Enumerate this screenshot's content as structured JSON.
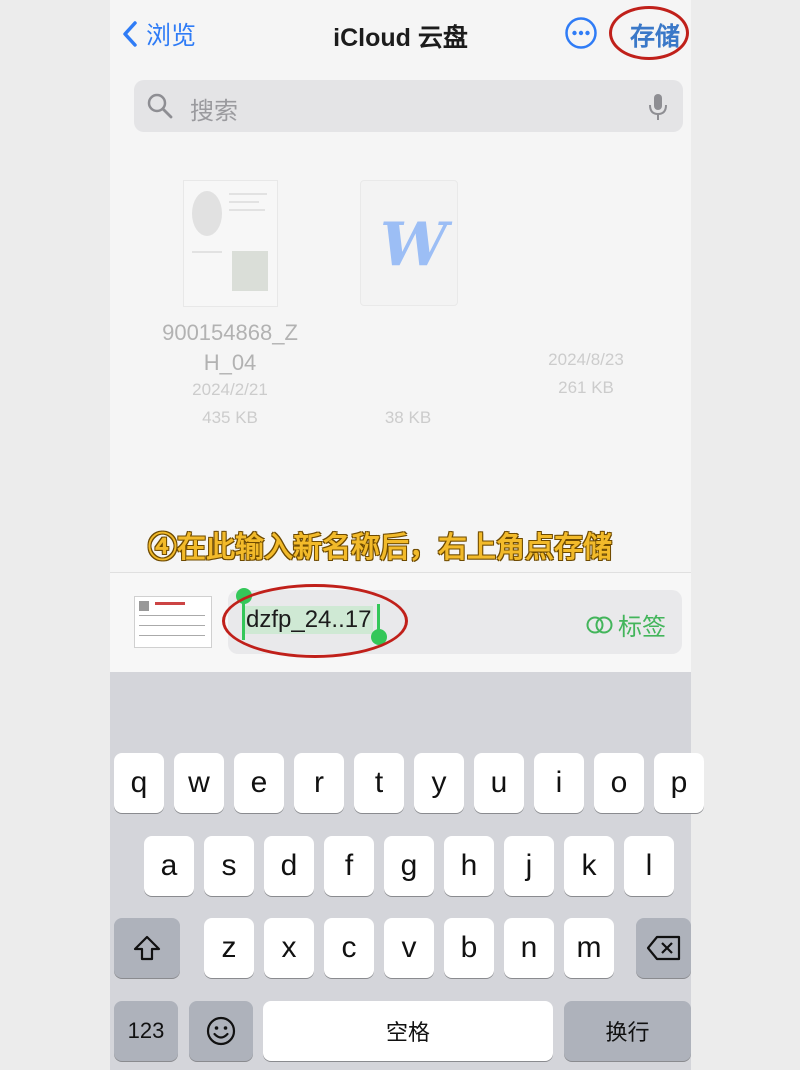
{
  "nav": {
    "back_label": "浏览",
    "title": "iCloud 云盘",
    "save_label": "存储"
  },
  "search": {
    "placeholder": "搜索"
  },
  "files": [
    {
      "name_line1": "900154868_Z",
      "name_line2": "H_04",
      "date": "2024/2/21",
      "size": "435 KB"
    },
    {
      "name_line1": "",
      "name_line2": "",
      "date": "",
      "size": "38 KB"
    },
    {
      "name_line1": "",
      "name_line2": "",
      "date": "2024/8/23",
      "size": "261 KB"
    }
  ],
  "annotation": "④在此输入新名称后，右上角点存储",
  "rename": {
    "value": "dzfp_24..17",
    "tag_label": "标签"
  },
  "keyboard": {
    "row1": [
      "q",
      "w",
      "e",
      "r",
      "t",
      "y",
      "u",
      "i",
      "o",
      "p"
    ],
    "row2": [
      "a",
      "s",
      "d",
      "f",
      "g",
      "h",
      "j",
      "k",
      "l"
    ],
    "row3": [
      "z",
      "x",
      "c",
      "v",
      "b",
      "n",
      "m"
    ],
    "numbers": "123",
    "space": "空格",
    "return": "换行"
  },
  "colors": {
    "accent": "#2f7cf6",
    "annotation": "#f2ba2a",
    "highlight_circle": "#c0201a",
    "tag": "#43b55b"
  }
}
